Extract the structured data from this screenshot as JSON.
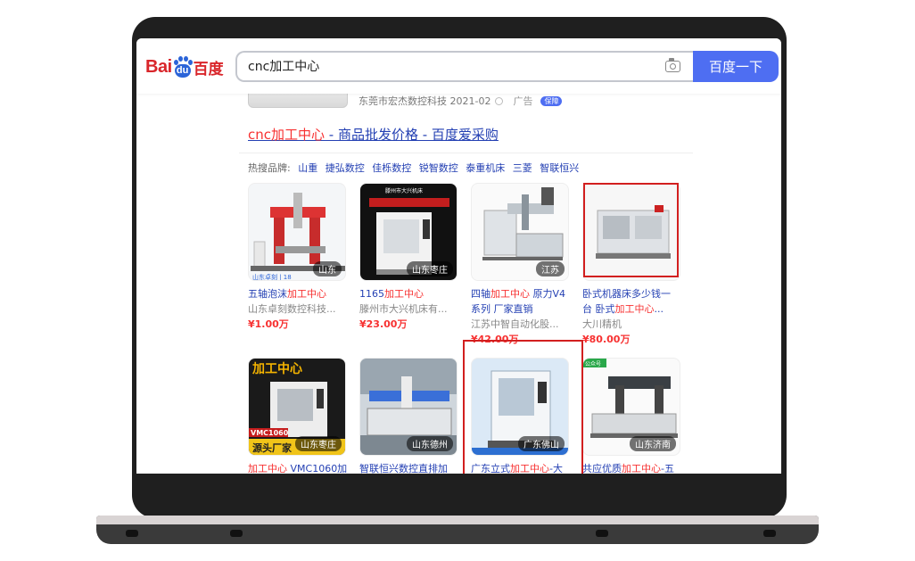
{
  "header": {
    "logo": {
      "text_bai": "Bai",
      "text_du": "du",
      "text_cn": "百度"
    },
    "search_value": "cnc加工中心",
    "search_button": "百度一下",
    "icons": {
      "camera": "camera-icon"
    }
  },
  "prev_result": {
    "source": "东莞市宏杰数控科技 2021-02",
    "ad_label": "广告",
    "badge": "保障"
  },
  "result": {
    "title_highlight": "cnc加工中心",
    "title_rest": " - 商品批发价格 - 百度爱采购",
    "hot_label": "热搜品牌:",
    "brands": [
      "山重",
      "捷弘数控",
      "佳栎数控",
      "锐智数控",
      "泰重机床",
      "三菱",
      "智联恒兴"
    ]
  },
  "products": [
    {
      "tag": "山东",
      "name_pre": "五轴泡沫",
      "name_hl": "加工中心",
      "name_post": "",
      "company": "山东卓刻数控科技...",
      "price": "¥1.00万",
      "img_caption": "山东卓刻 | 18"
    },
    {
      "tag": "山东枣庄",
      "name_pre": "1165",
      "name_hl": "加工中心",
      "name_post": "",
      "company": "滕州市大兴机床有...",
      "price": "¥23.00万",
      "img_caption": "滕州市大兴机床"
    },
    {
      "tag": "江苏",
      "name_pre": "四轴",
      "name_hl": "加工中心",
      "name_post": " 原力V4",
      "name_line2": "系列 厂家直销",
      "company": "江苏中智自动化股...",
      "price": "¥42.00万"
    },
    {
      "tag": "",
      "name_pre": "卧式机器床多少钱一",
      "name_hl": "",
      "name_post": "",
      "name_line2_pre": "台 卧式",
      "name_line2_hl": "加工中心",
      "name_line2_post": "...",
      "company": "大川精机",
      "price": "¥80.00万"
    },
    {
      "tag": "山东枣庄",
      "name_pre": "",
      "name_hl": "加工中心",
      "name_post": " VMC1060加",
      "img_title": "加工中心",
      "img_badge": "VMC1060",
      "img_footer": "源头厂家"
    },
    {
      "tag": "山东德州",
      "name_pre": "智联恒兴数控直排加",
      "name_hl": "",
      "name_post": ""
    },
    {
      "tag": "广东佛山",
      "name_pre": "广东立式",
      "name_hl": "加工中心",
      "name_post": "-大"
    },
    {
      "tag": "山东济南",
      "name_pre": "共应优质",
      "name_hl": "加工中心",
      "name_post": "-五",
      "img_corner": "公众号"
    }
  ]
}
